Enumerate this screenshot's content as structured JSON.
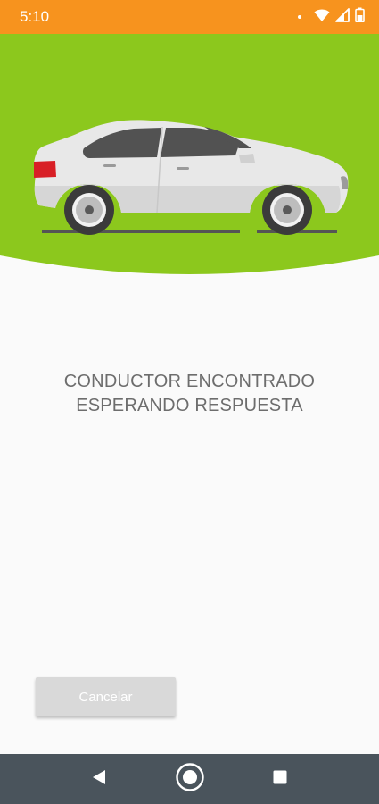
{
  "status_bar": {
    "time": "5:10",
    "icons": [
      "notification-dot-icon",
      "wifi-icon",
      "cell-signal-icon",
      "battery-icon"
    ],
    "background_color": "#f7931e"
  },
  "hero": {
    "background_color": "#8cc81d",
    "illustration": "car-icon"
  },
  "message": {
    "line1": "CONDUCTOR ENCONTRADO",
    "line2": "ESPERANDO RESPUESTA",
    "color": "#6d6d6d"
  },
  "actions": {
    "cancel_label": "Cancelar",
    "cancel_color": "#d9d9d9"
  },
  "navigation_bar": {
    "buttons": [
      "back-icon",
      "home-icon",
      "recents-icon"
    ],
    "background_color": "#4a545c"
  }
}
